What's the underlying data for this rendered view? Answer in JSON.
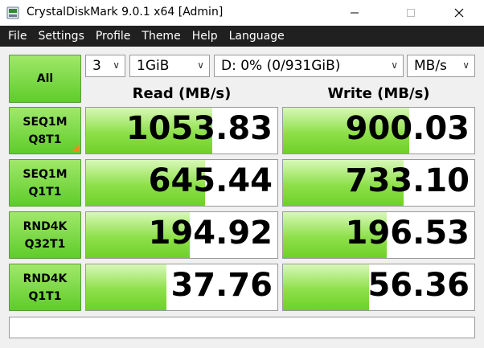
{
  "window": {
    "title": "CrystalDiskMark 9.0.1 x64 [Admin]"
  },
  "menu": [
    "File",
    "Settings",
    "Profile",
    "Theme",
    "Help",
    "Language"
  ],
  "controls": {
    "all_label": "All",
    "count": "3",
    "size": "1GiB",
    "drive": "D: 0% (0/931GiB)",
    "unit": "MB/s"
  },
  "headers": {
    "read": "Read (MB/s)",
    "write": "Write (MB/s)"
  },
  "tests": [
    {
      "line1": "SEQ1M",
      "line2": "Q8T1",
      "read": "1053.83",
      "write": "900.03",
      "read_level": 0.66,
      "write_level": 0.66
    },
    {
      "line1": "SEQ1M",
      "line2": "Q1T1",
      "read": "645.44",
      "write": "733.10",
      "read_level": 0.62,
      "write_level": 0.63
    },
    {
      "line1": "RND4K",
      "line2": "Q32T1",
      "read": "194.92",
      "write": "196.53",
      "read_level": 0.54,
      "write_level": 0.54
    },
    {
      "line1": "RND4K",
      "line2": "Q1T1",
      "read": "37.76",
      "write": "56.36",
      "read_level": 0.42,
      "write_level": 0.45
    }
  ],
  "comment": "",
  "colors": {
    "accent_green": "#6fd028",
    "menubar_bg": "#202020",
    "marker_orange": "#f08a1a"
  }
}
